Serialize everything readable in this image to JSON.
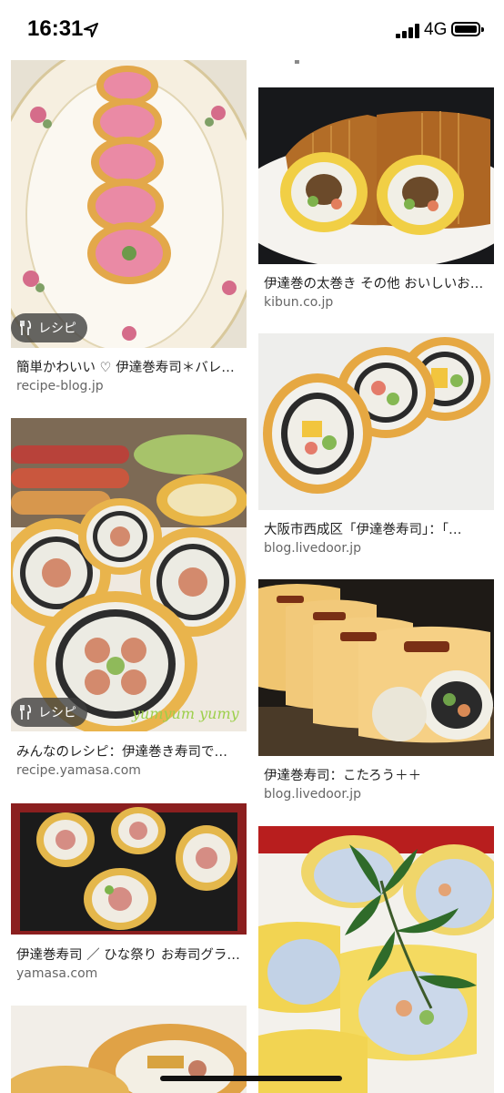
{
  "status": {
    "time": "16:31",
    "network": "4G",
    "location_icon": "location-arrow-icon"
  },
  "left": [
    {
      "caption": "簡単かわいい ♡ 伊達巻寿司＊バレ…",
      "domain": "recipe-blog.jp",
      "badge": "レシピ"
    },
    {
      "caption": "みんなのレシピ：伊達巻き寿司で…",
      "domain": "recipe.yamasa.com",
      "badge": "レシピ",
      "watermark": "yumyum yumy"
    },
    {
      "caption": "伊達巻寿司 ／ ひな祭り お寿司グラ…",
      "domain": "yamasa.com"
    }
  ],
  "right": [
    {
      "caption": "伊達巻の太巻き その他 おいしいお…",
      "domain": "kibun.co.jp"
    },
    {
      "caption": "大阪市西成区「伊達巻寿司」：「…",
      "domain": "blog.livedoor.jp"
    },
    {
      "caption": "伊達巻寿司：こたろう＋＋",
      "domain": "blog.livedoor.jp"
    }
  ],
  "colors": {
    "egg": "#e8b646",
    "rice": "#f1f0ea",
    "nori": "#2b2b2b",
    "pink": "#e88aa0",
    "plate": "#f4ece0"
  }
}
